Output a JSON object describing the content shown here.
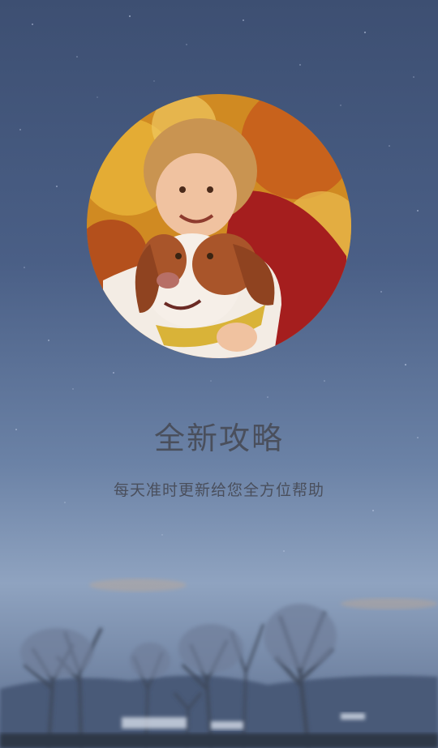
{
  "splash": {
    "title": "全新攻略",
    "subtitle": "每天准时更新给您全方位帮助"
  }
}
